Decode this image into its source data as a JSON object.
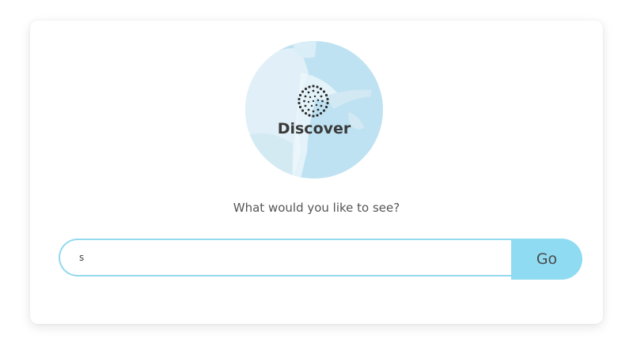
{
  "logo": {
    "text": "Discover",
    "icon": "dotted-spiral-icon"
  },
  "prompt": {
    "text": "What would you like to see?"
  },
  "search": {
    "value": "s",
    "placeholder": ""
  },
  "go_button": {
    "label": "Go"
  },
  "colors": {
    "accent": "#8fdcf2",
    "input_border": "#93d9ee",
    "logo_bg": "#bfe2f2",
    "text": "#555555"
  }
}
